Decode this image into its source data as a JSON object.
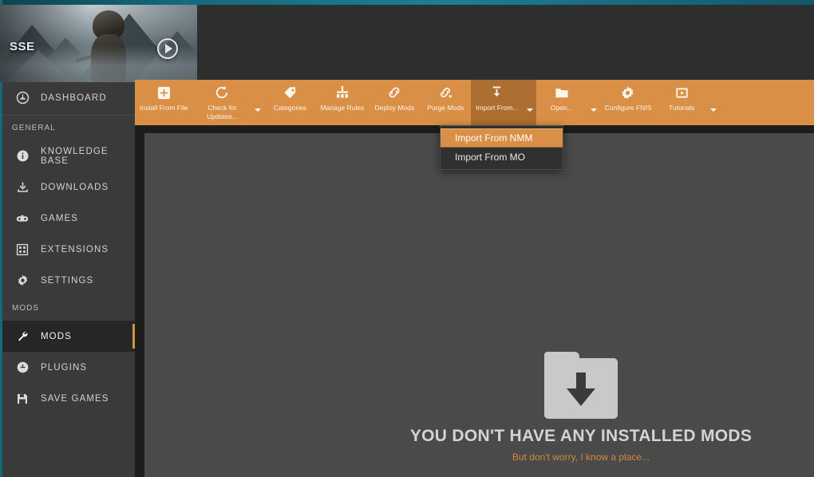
{
  "app": {
    "accent_color": "#d98f46",
    "top_strip_color": "#16697b",
    "sidebar_bg": "#3a3a3a",
    "panel_bg": "#4a4a4a"
  },
  "sidebar": {
    "banner": {
      "title": "SSE",
      "play_icon": "play-circle-icon"
    },
    "dashboard": {
      "label": "DASHBOARD",
      "icon": "dashboard-icon"
    },
    "groups": [
      {
        "label": "GENERAL",
        "items": [
          {
            "label": "KNOWLEDGE BASE",
            "icon": "info-icon",
            "active": false
          },
          {
            "label": "DOWNLOADS",
            "icon": "download-icon",
            "active": false
          },
          {
            "label": "GAMES",
            "icon": "gamepad-icon",
            "active": false
          },
          {
            "label": "EXTENSIONS",
            "icon": "grid-icon",
            "active": false
          },
          {
            "label": "SETTINGS",
            "icon": "gear-icon",
            "active": false
          }
        ]
      },
      {
        "label": "MODS",
        "items": [
          {
            "label": "MODS",
            "icon": "wrench-icon",
            "active": true
          },
          {
            "label": "PLUGINS",
            "icon": "plug-icon",
            "active": false
          },
          {
            "label": "SAVE GAMES",
            "icon": "save-icon",
            "active": false
          }
        ]
      }
    ]
  },
  "toolbar": {
    "buttons": [
      {
        "label": "Install From File",
        "icon": "plus-square-icon",
        "caret": false,
        "pressed": false
      },
      {
        "label": "Check for Updates...",
        "icon": "refresh-icon",
        "caret": true,
        "pressed": false
      },
      {
        "label": "Categories",
        "icon": "tag-icon",
        "caret": false,
        "pressed": false
      },
      {
        "label": "Manage Rules",
        "icon": "rules-icon",
        "caret": false,
        "pressed": false
      },
      {
        "label": "Deploy Mods",
        "icon": "link-icon",
        "caret": false,
        "pressed": false
      },
      {
        "label": "Purge Mods",
        "icon": "unlink-icon",
        "caret": false,
        "pressed": false
      },
      {
        "label": "Import From...",
        "icon": "import-icon",
        "caret": true,
        "pressed": true
      },
      {
        "label": "Open...",
        "icon": "folder-icon",
        "caret": true,
        "pressed": false
      },
      {
        "label": "Configure FNIS",
        "icon": "gear-icon",
        "caret": false,
        "pressed": false
      },
      {
        "label": "Tutorials",
        "icon": "video-icon",
        "caret": true,
        "pressed": false
      }
    ]
  },
  "dropdown": {
    "open": true,
    "items": [
      {
        "label": "Import From NMM",
        "highlighted": true
      },
      {
        "label": "Import From MO",
        "highlighted": false
      }
    ]
  },
  "main": {
    "empty_state": {
      "icon": "folder-download-icon",
      "title": "YOU DON'T HAVE ANY INSTALLED MODS",
      "subtitle": "But don't worry, I know a place..."
    }
  }
}
